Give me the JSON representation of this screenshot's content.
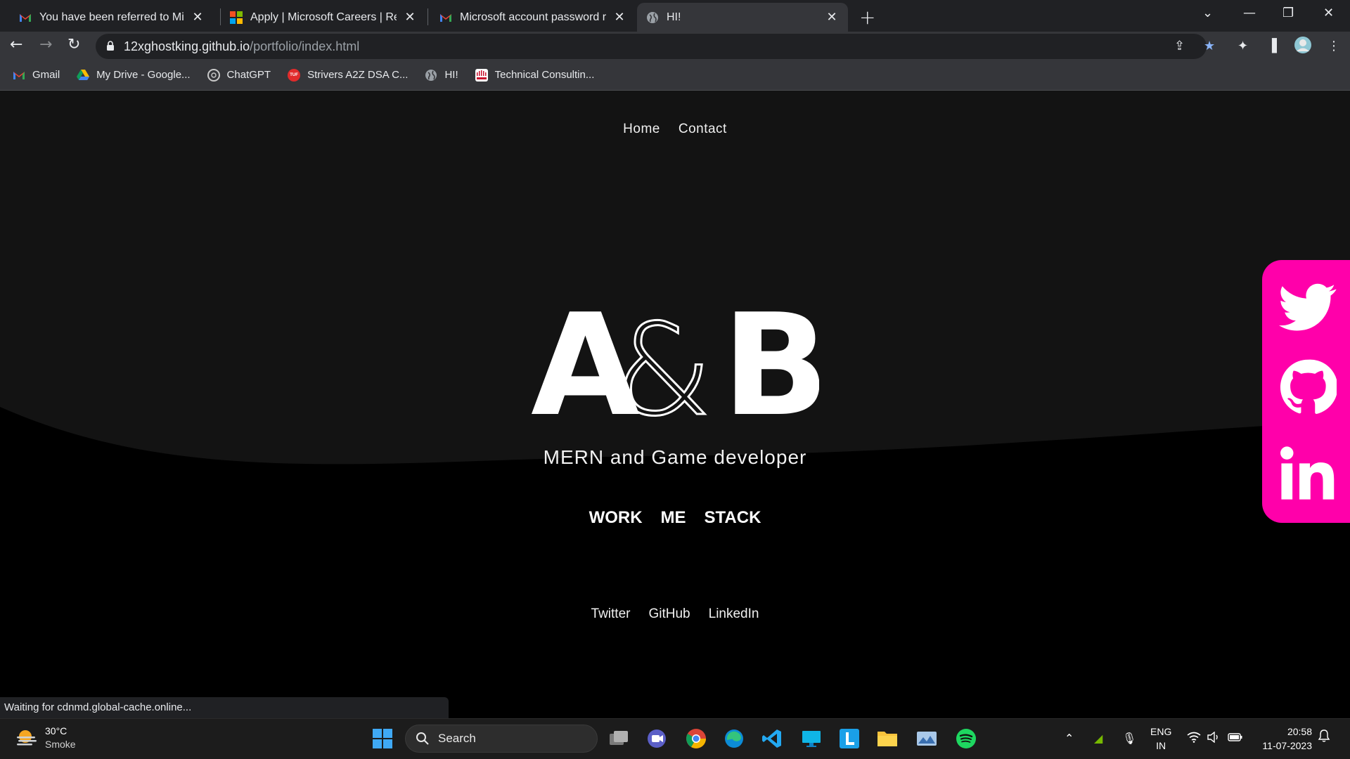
{
  "browser": {
    "tabs": [
      {
        "title": "You have been referred to Micros",
        "icon": "gmail-icon"
      },
      {
        "title": "Apply | Microsoft Careers | Resea",
        "icon": "microsoft-icon"
      },
      {
        "title": "Microsoft account password rese",
        "icon": "gmail-icon"
      },
      {
        "title": "HI!",
        "icon": "globe-icon"
      }
    ],
    "url_host": "12xghostking.github.io",
    "url_path": "/portfolio/index.html",
    "bookmarks": [
      {
        "label": "Gmail",
        "icon": "gmail-icon"
      },
      {
        "label": "My Drive - Google...",
        "icon": "drive-icon"
      },
      {
        "label": "ChatGPT",
        "icon": "chatgpt-icon"
      },
      {
        "label": "Strivers A2Z DSA C...",
        "icon": "tuf-icon"
      },
      {
        "label": "HI!",
        "icon": "globe-icon"
      },
      {
        "label": "Technical Consultin...",
        "icon": "cisco-icon"
      }
    ],
    "status_text": "Waiting for cdnmd.global-cache.online..."
  },
  "page": {
    "nav": {
      "home": "Home",
      "contact": "Contact"
    },
    "logo": {
      "left": "A",
      "amp": "&",
      "right": "B"
    },
    "tagline": "MERN and Game developer",
    "sections": {
      "work": "WORK",
      "me": "ME",
      "stack": "STACK"
    },
    "social_links": {
      "twitter": "Twitter",
      "github": "GitHub",
      "linkedin": "LinkedIn"
    },
    "accent_color": "#ff00aa"
  },
  "taskbar": {
    "weather": {
      "temp": "30°C",
      "condition": "Smoke"
    },
    "search_placeholder": "Search",
    "language": {
      "line1": "ENG",
      "line2": "IN"
    },
    "clock": {
      "time": "20:58",
      "date": "11-07-2023"
    }
  }
}
